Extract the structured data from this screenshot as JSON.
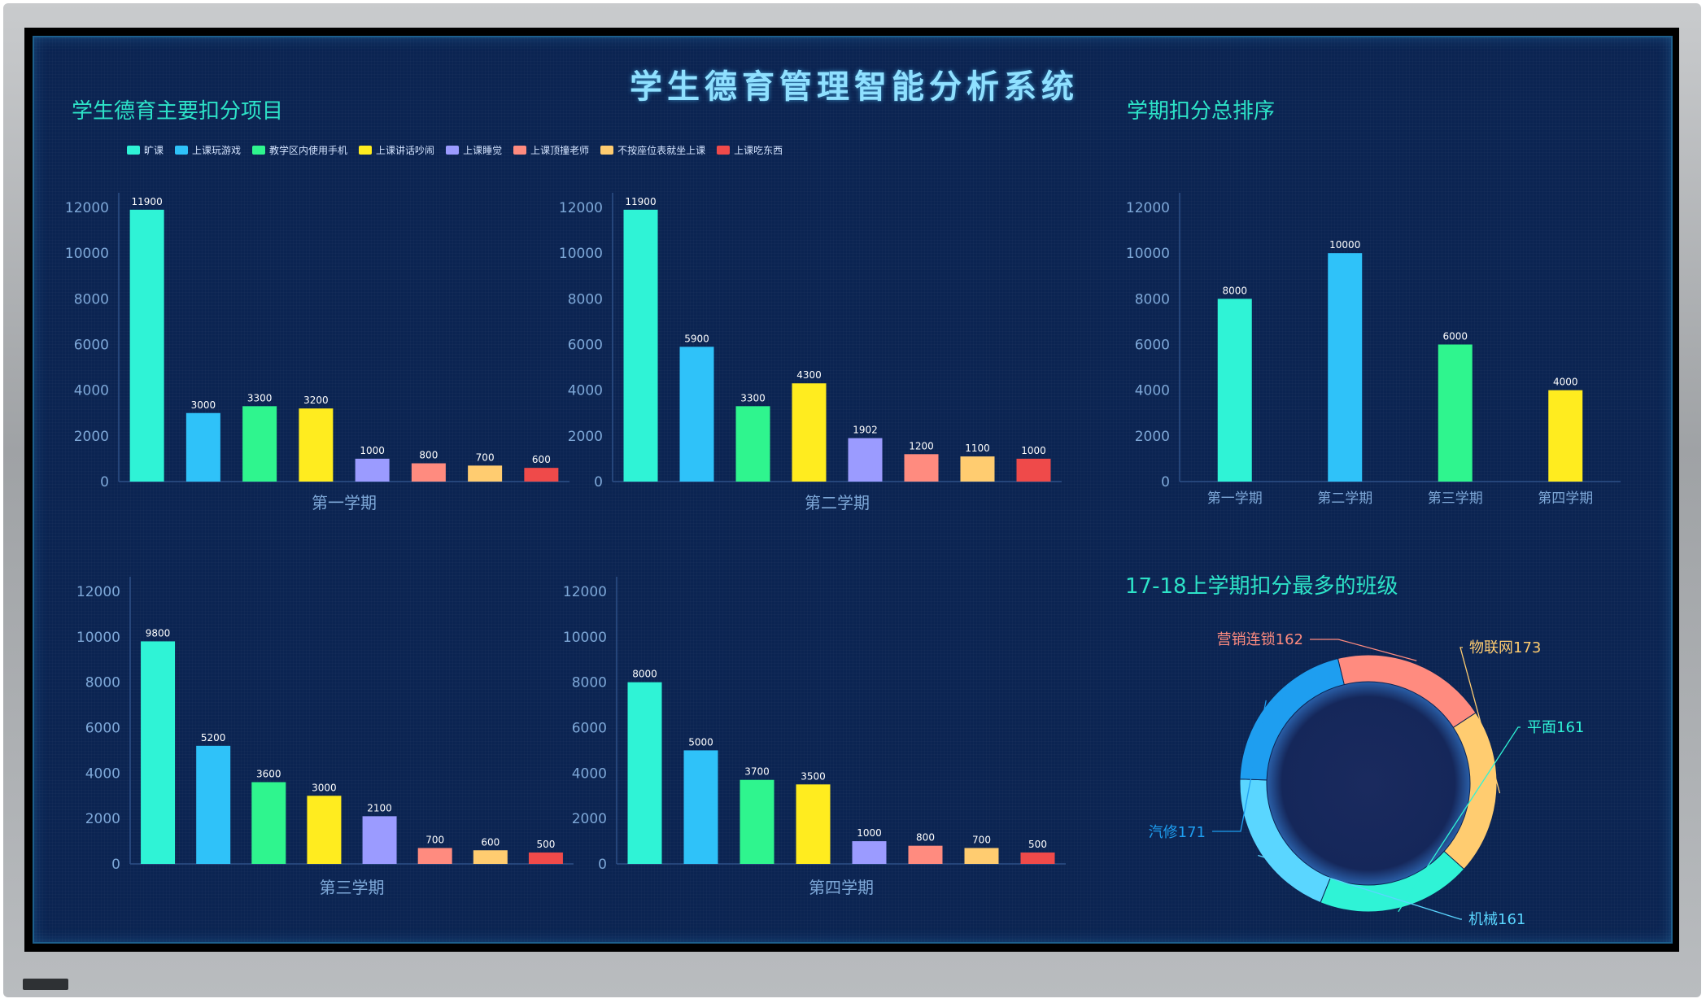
{
  "title": "学生德育管理智能分析系统",
  "sections": {
    "left": "学生德育主要扣分项目",
    "right_top": "学期扣分总排序",
    "right_bottom": "17-18上学期扣分最多的班级"
  },
  "legend": [
    {
      "label": "旷课",
      "color": "#2ff3d6"
    },
    {
      "label": "上课玩游戏",
      "color": "#2fc2f9"
    },
    {
      "label": "教学区内使用手机",
      "color": "#2ff58e"
    },
    {
      "label": "上课讲话吵闹",
      "color": "#ffec1f"
    },
    {
      "label": "上课睡觉",
      "color": "#9b9bff"
    },
    {
      "label": "上课顶撞老师",
      "color": "#ff8b7f"
    },
    {
      "label": "不按座位表就坐上课",
      "color": "#ffcc70"
    },
    {
      "label": "上课吃东西",
      "color": "#ef4a4a"
    }
  ],
  "colors": {
    "axis_text": "#7ea8d8",
    "label_text": "#ffffff",
    "title": "#2de3c8",
    "axis_line": "#2d4f86"
  },
  "chart_data": [
    {
      "type": "bar",
      "title": "第一学期",
      "ylim": [
        0,
        12000
      ],
      "yticks": [
        0,
        2000,
        4000,
        6000,
        8000,
        10000,
        12000
      ],
      "categories": [
        "旷课",
        "上课玩游戏",
        "教学区内使用手机",
        "上课讲话吵闹",
        "上课睡觉",
        "上课顶撞老师",
        "不按座位表就坐上课",
        "上课吃东西"
      ],
      "values": [
        11900,
        3000,
        3300,
        3200,
        1000,
        800,
        700,
        600
      ]
    },
    {
      "type": "bar",
      "title": "第二学期",
      "ylim": [
        0,
        12000
      ],
      "yticks": [
        0,
        2000,
        4000,
        6000,
        8000,
        10000,
        12000
      ],
      "categories": [
        "旷课",
        "上课玩游戏",
        "教学区内使用手机",
        "上课讲话吵闹",
        "上课睡觉",
        "上课顶撞老师",
        "不按座位表就坐上课",
        "上课吃东西"
      ],
      "values": [
        11900,
        5900,
        3300,
        4300,
        1902,
        1200,
        1100,
        1000
      ]
    },
    {
      "type": "bar",
      "title": "第三学期",
      "ylim": [
        0,
        12000
      ],
      "yticks": [
        0,
        2000,
        4000,
        6000,
        8000,
        10000,
        12000
      ],
      "categories": [
        "旷课",
        "上课玩游戏",
        "教学区内使用手机",
        "上课讲话吵闹",
        "上课睡觉",
        "上课顶撞老师",
        "不按座位表就坐上课",
        "上课吃东西"
      ],
      "values": [
        9800,
        5200,
        3600,
        3000,
        2100,
        700,
        600,
        500
      ]
    },
    {
      "type": "bar",
      "title": "第四学期",
      "ylim": [
        0,
        12000
      ],
      "yticks": [
        0,
        2000,
        4000,
        6000,
        8000,
        10000,
        12000
      ],
      "categories": [
        "旷课",
        "上课玩游戏",
        "教学区内使用手机",
        "上课讲话吵闹",
        "上课睡觉",
        "上课顶撞老师",
        "不按座位表就坐上课",
        "上课吃东西"
      ],
      "values": [
        8000,
        5000,
        3700,
        3500,
        1000,
        800,
        700,
        500
      ]
    },
    {
      "type": "bar",
      "title": "学期扣分总排序",
      "ylim": [
        0,
        12000
      ],
      "yticks": [
        0,
        2000,
        4000,
        6000,
        8000,
        10000,
        12000
      ],
      "categories": [
        "第一学期",
        "第二学期",
        "第三学期",
        "第四学期"
      ],
      "values": [
        8000,
        10000,
        6000,
        4000
      ],
      "colors": [
        "#2ff3d6",
        "#2fc2f9",
        "#2ff58e",
        "#ffec1f"
      ]
    },
    {
      "type": "pie",
      "title": "17-18上学期扣分最多的班级",
      "slices": [
        {
          "label": "营销连锁",
          "value": 162,
          "color": "#ff8b7f"
        },
        {
          "label": "物联网",
          "value": 173,
          "color": "#ffcc70"
        },
        {
          "label": "平面",
          "value": 161,
          "color": "#2ff3d6"
        },
        {
          "label": "机械",
          "value": 161,
          "color": "#5ad6ff"
        },
        {
          "label": "汽修",
          "value": 171,
          "color": "#1e9ef0"
        }
      ]
    }
  ]
}
